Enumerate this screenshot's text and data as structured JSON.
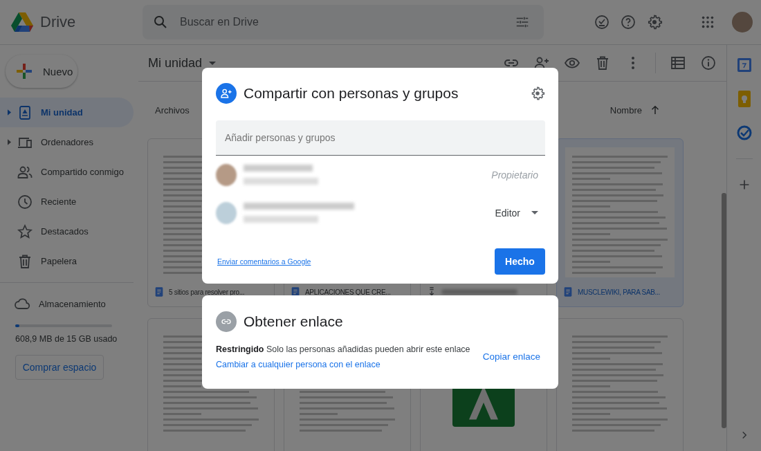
{
  "app": {
    "name": "Drive"
  },
  "search": {
    "placeholder": "Buscar en Drive"
  },
  "sidebar": {
    "new_button": "Nuevo",
    "items": [
      {
        "label": "Mi unidad",
        "expandable": true,
        "selected": true
      },
      {
        "label": "Ordenadores",
        "expandable": true,
        "selected": false
      },
      {
        "label": "Compartido conmigo",
        "expandable": false,
        "selected": false
      },
      {
        "label": "Reciente",
        "expandable": false,
        "selected": false
      },
      {
        "label": "Destacados",
        "expandable": false,
        "selected": false
      },
      {
        "label": "Papelera",
        "expandable": false,
        "selected": false
      }
    ],
    "storage": {
      "label": "Almacenamiento",
      "level": 0.04,
      "usage": "608,9 MB de 15 GB usado",
      "button": "Comprar espacio"
    }
  },
  "main": {
    "title": "Mi unidad",
    "section": "Archivos",
    "sort": "Nombre",
    "files": [
      {
        "name": "5 sitios para resolver pro...",
        "kind": "doc",
        "selected": false
      },
      {
        "name": "APLICACIONES QUE CRE...",
        "kind": "doc",
        "selected": false
      },
      {
        "kind": "file",
        "selected": false
      },
      {
        "name": "MUSCLEWIKI, PARA SAB...",
        "kind": "doc",
        "selected": true
      }
    ],
    "more_files": [
      {
        "kind": "text"
      },
      {
        "kind": "text"
      },
      {
        "kind": "sheet"
      },
      {
        "kind": "text"
      }
    ]
  },
  "share_dialog": {
    "title": "Compartir con personas y grupos",
    "input": {
      "placeholder": "Añadir personas y grupos"
    },
    "people": [
      {
        "role": "Propietario",
        "editable": false
      },
      {
        "role": "Editor",
        "editable": true
      }
    ],
    "feedback_link": "Enviar comentarios a Google",
    "done_button": "Hecho"
  },
  "link_dialog": {
    "title": "Obtener enlace",
    "description": "**Restringido** Solo las personas añadidas pueden abrir este enlace",
    "change_link": "Cambiar a cualquier persona con el enlace",
    "copy_button": "Copiar enlace"
  }
}
